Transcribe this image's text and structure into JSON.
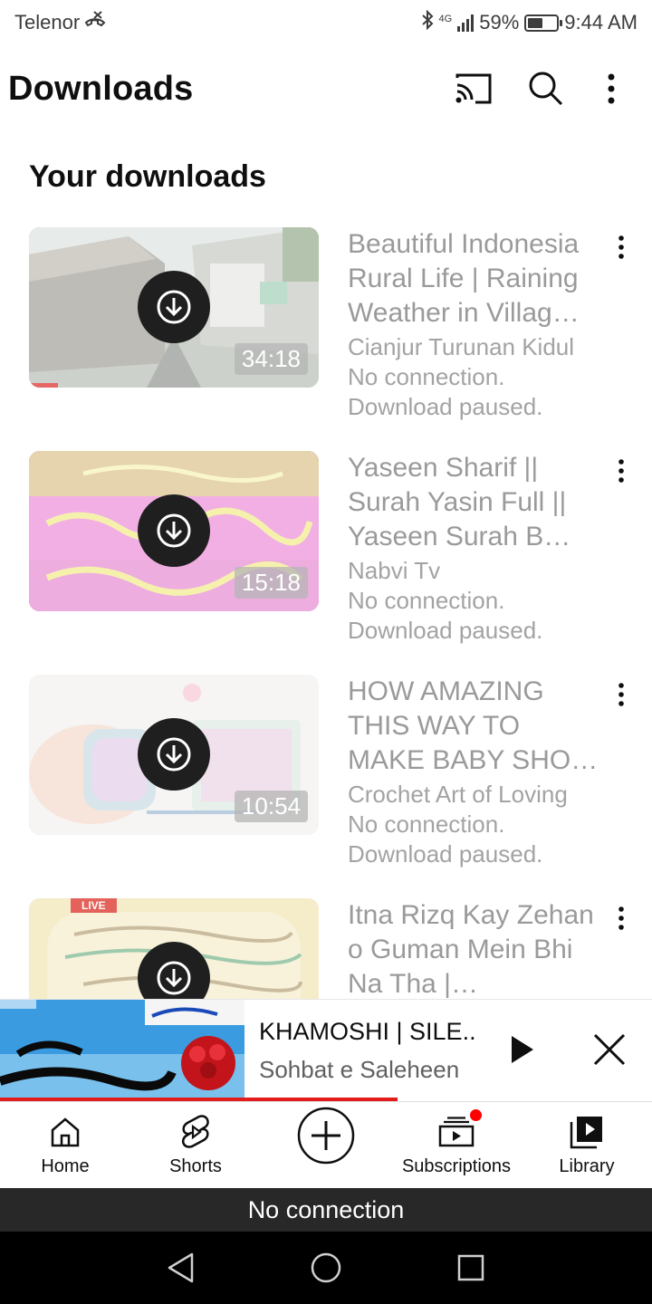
{
  "status_bar": {
    "carrier": "Telenor",
    "network": "4G",
    "battery": "59%",
    "battery_level": 0.59,
    "time": "9:44 AM"
  },
  "header": {
    "title": "Downloads",
    "icons": [
      "cast-icon",
      "search-icon",
      "more-vert-icon"
    ]
  },
  "section": {
    "title": "Your downloads"
  },
  "downloads": [
    {
      "title": "Beautiful Indonesia Rural Life | Raining Weather in Villag…",
      "channel": "Cianjur Turunan Kidul",
      "connection": "No connection.",
      "status": "Download paused.",
      "duration": "34:18",
      "progress": 0.1
    },
    {
      "title": "Yaseen Sharif || Surah Yasin Full || Yaseen Surah B…",
      "channel": "Nabvi Tv",
      "connection": "No connection.",
      "status": "Download paused.",
      "duration": "15:18",
      "progress": 0
    },
    {
      "title": "HOW AMAZING THIS WAY TO MAKE BABY SHO…",
      "channel": "Crochet Art of Loving",
      "connection": "No connection.",
      "status": "Download paused.",
      "duration": "10:54",
      "progress": 0
    },
    {
      "title": "Itna Rizq Kay Zehan o Guman Mein Bhi Na Tha |…",
      "badge": "LIVE"
    }
  ],
  "mini_player": {
    "title": "KHAMOSHI | SILE..",
    "channel": "Sohbat e Saleheen",
    "progress": 0.61
  },
  "bottom_nav": [
    {
      "label": "Home",
      "icon": "home-icon"
    },
    {
      "label": "Shorts",
      "icon": "shorts-icon"
    },
    {
      "label": "",
      "icon": "create-icon"
    },
    {
      "label": "Subscriptions",
      "icon": "subscriptions-icon"
    },
    {
      "label": "Library",
      "icon": "library-icon"
    }
  ],
  "banner": {
    "text": "No connection"
  },
  "colors": {
    "accent": "#ff0000",
    "text_primary": "#0f0f0f",
    "text_muted": "#9a9a9a",
    "banner_bg": "#282828"
  }
}
